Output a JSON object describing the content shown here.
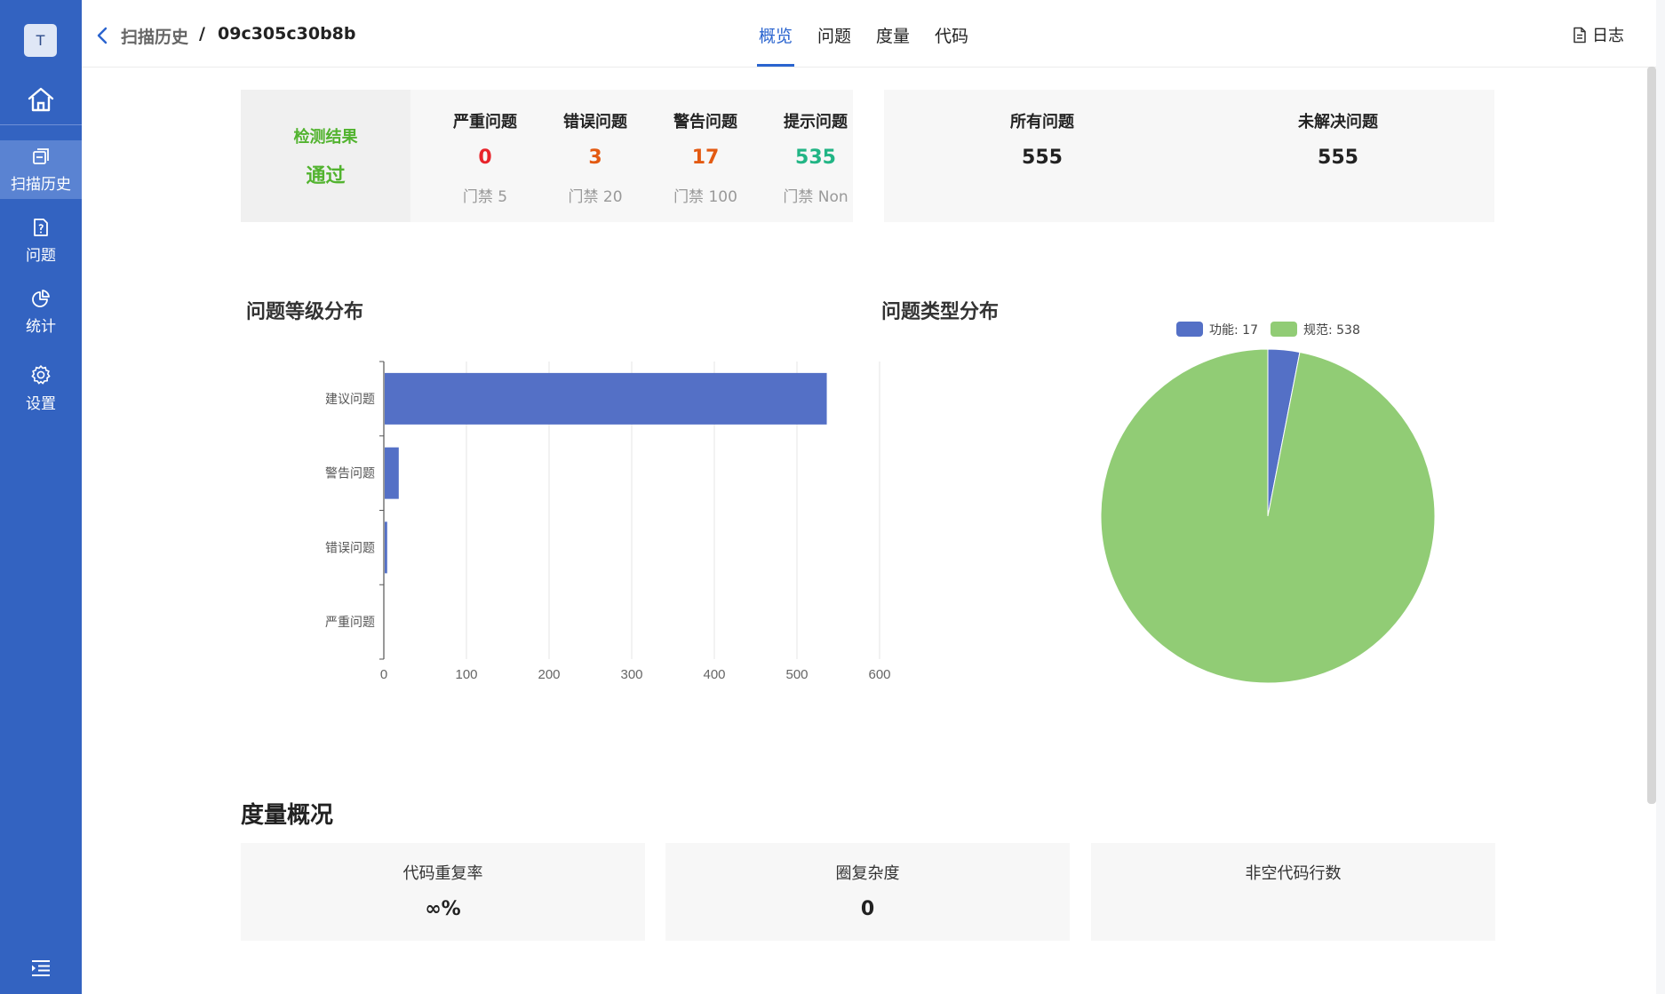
{
  "sidebar": {
    "avatar": "T",
    "items": [
      {
        "label": "扫描历史",
        "icon": "history-icon"
      },
      {
        "label": "问题",
        "icon": "issue-file-icon"
      },
      {
        "label": "统计",
        "icon": "pie-chart-icon"
      },
      {
        "label": "设置",
        "icon": "gear-icon"
      }
    ]
  },
  "header": {
    "breadcrumb_parent": "扫描历史",
    "breadcrumb_sep": "/",
    "breadcrumb_current": "09c305c30b8b",
    "tabs": [
      "概览",
      "问题",
      "度量",
      "代码"
    ],
    "active_tab": "概览",
    "log_label": "日志"
  },
  "result": {
    "label": "检测结果",
    "status": "通过",
    "status_color": "#52b32f",
    "columns": [
      {
        "title": "严重问题",
        "value": "0",
        "gate": "门禁 5",
        "color": "#e8242b"
      },
      {
        "title": "错误问题",
        "value": "3",
        "gate": "门禁 20",
        "color": "#e35a12"
      },
      {
        "title": "警告问题",
        "value": "17",
        "gate": "门禁 100",
        "color": "#e35a12"
      },
      {
        "title": "提示问题",
        "value": "535",
        "gate": "门禁 Non",
        "color": "#22b585"
      }
    ]
  },
  "totals": {
    "all_label": "所有问题",
    "all_value": "555",
    "unresolved_label": "未解决问题",
    "unresolved_value": "555"
  },
  "charts": {
    "level_title": "问题等级分布",
    "type_title": "问题类型分布"
  },
  "chart_data": [
    {
      "type": "bar",
      "orientation": "horizontal",
      "categories": [
        "建议问题",
        "警告问题",
        "错误问题",
        "严重问题"
      ],
      "values": [
        535,
        17,
        3,
        0
      ],
      "color": "#5470c6",
      "xlim": [
        0,
        600
      ],
      "xticks": [
        "0",
        "100",
        "200",
        "300",
        "400",
        "500",
        "600"
      ],
      "grid": true
    },
    {
      "type": "pie",
      "legend_position": "top",
      "slices": [
        {
          "name": "功能",
          "value": 17,
          "color": "#5470c6"
        },
        {
          "name": "规范",
          "value": 538,
          "color": "#91cc75"
        }
      ],
      "legend_labels": [
        "功能: 17",
        "规范: 538"
      ]
    }
  ],
  "metrics": {
    "title": "度量概况",
    "cards": [
      {
        "label": "代码重复率",
        "value": "∞%"
      },
      {
        "label": "圈复杂度",
        "value": "0"
      },
      {
        "label": "非空代码行数",
        "value": ""
      }
    ]
  }
}
